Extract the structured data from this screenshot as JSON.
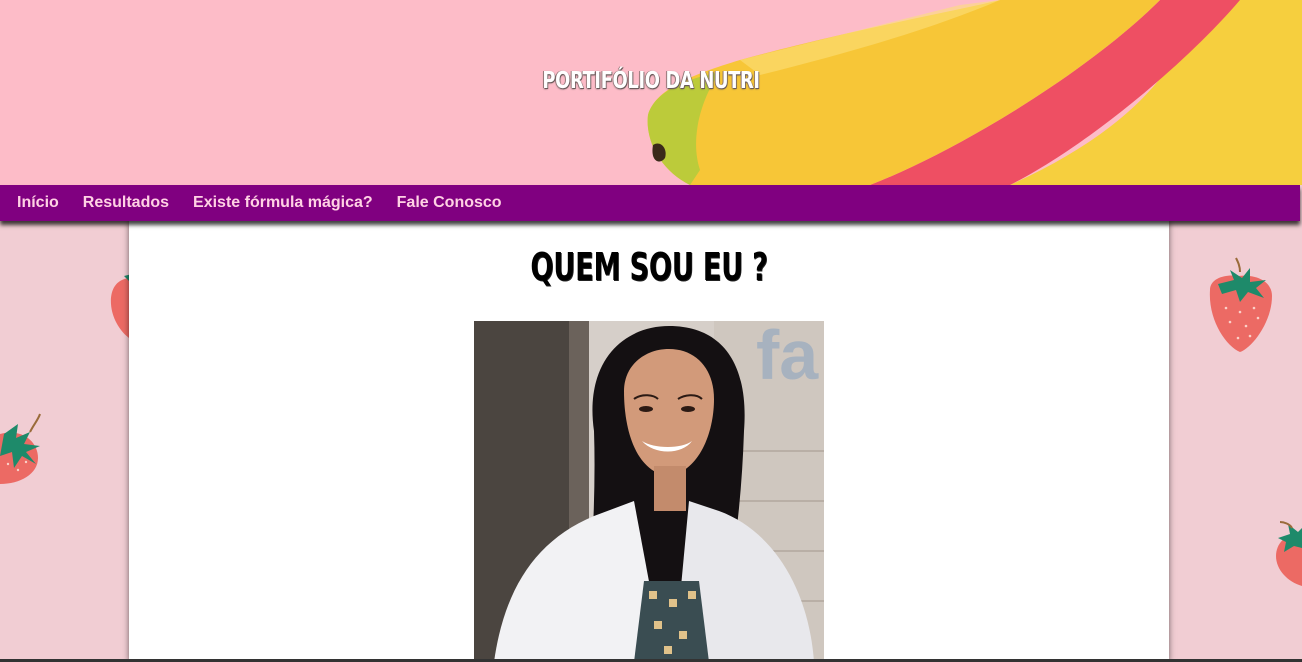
{
  "header": {
    "site_title": "PORTIFÓLIO DA NUTRI",
    "banner_image": "bananas-on-pink-background"
  },
  "nav": {
    "items": [
      {
        "label": "Início"
      },
      {
        "label": "Resultados"
      },
      {
        "label": "Existe fórmula mágica?"
      },
      {
        "label": "Fale Conosco"
      }
    ]
  },
  "main": {
    "section_title": "QUEM SOU EU ?",
    "portrait_image": "nutritionist-portrait-photo",
    "portrait_partial_text": "fa"
  },
  "background": {
    "pattern": "strawberry-pattern",
    "color": "#f1cdd3"
  },
  "colors": {
    "nav_bg": "#800080",
    "nav_text": "#ffd1e4",
    "banner_bg": "#fdbcc8",
    "panel_bg": "#ffffff"
  }
}
